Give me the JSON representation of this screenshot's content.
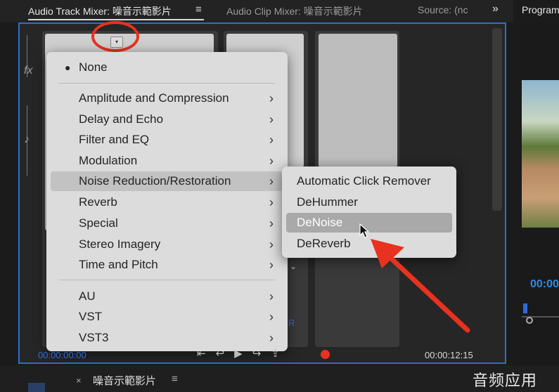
{
  "tabs": {
    "active": "Audio Track Mixer: 噪音示範影片",
    "menu_icon": "≡",
    "second": "Audio Clip Mixer: 噪音示範影片",
    "third": "Source: (nc",
    "more": "»",
    "program": "Program"
  },
  "mixer": {
    "fx_label": "fx",
    "dropdown_glyph": "▾",
    "r_label": "R",
    "timecode_left": "00:00:00:00",
    "timecode_right": "00:00:12:15"
  },
  "menu": {
    "items": [
      {
        "label": "None",
        "bullet": "●",
        "arrow": ""
      },
      {
        "label": "Amplitude and Compression",
        "arrow": "›"
      },
      {
        "label": "Delay and Echo",
        "arrow": "›"
      },
      {
        "label": "Filter and EQ",
        "arrow": "›"
      },
      {
        "label": "Modulation",
        "arrow": "›"
      },
      {
        "label": "Noise Reduction/Restoration",
        "arrow": "›"
      },
      {
        "label": "Reverb",
        "arrow": "›"
      },
      {
        "label": "Special",
        "arrow": "›"
      },
      {
        "label": "Stereo Imagery",
        "arrow": "›"
      },
      {
        "label": "Time and Pitch",
        "arrow": "›"
      },
      {
        "label": "AU",
        "arrow": "›"
      },
      {
        "label": "VST",
        "arrow": "›"
      },
      {
        "label": "VST3",
        "arrow": "›"
      }
    ]
  },
  "submenu": {
    "items": [
      {
        "label": "Automatic Click Remover"
      },
      {
        "label": "DeHummer"
      },
      {
        "label": "DeNoise"
      },
      {
        "label": "DeReverb"
      }
    ]
  },
  "program": {
    "timecode": "00:00"
  },
  "bottom": {
    "close": "×",
    "sequence_name": "噪音示範影片",
    "menu_icon": "≡"
  },
  "watermark": "音频应用",
  "colors": {
    "accent_blue": "#2f6bd6",
    "annotation_red": "#e8321f",
    "menu_bg": "#dcdcdc",
    "highlight": "#a9a9a9"
  },
  "icons": {
    "more": "double-chevron-right-icon",
    "menu": "hamburger-icon",
    "dropdown": "chevron-down-icon",
    "submenu": "chevron-right-icon",
    "record": "record-icon",
    "cursor": "mouse-pointer-icon"
  }
}
